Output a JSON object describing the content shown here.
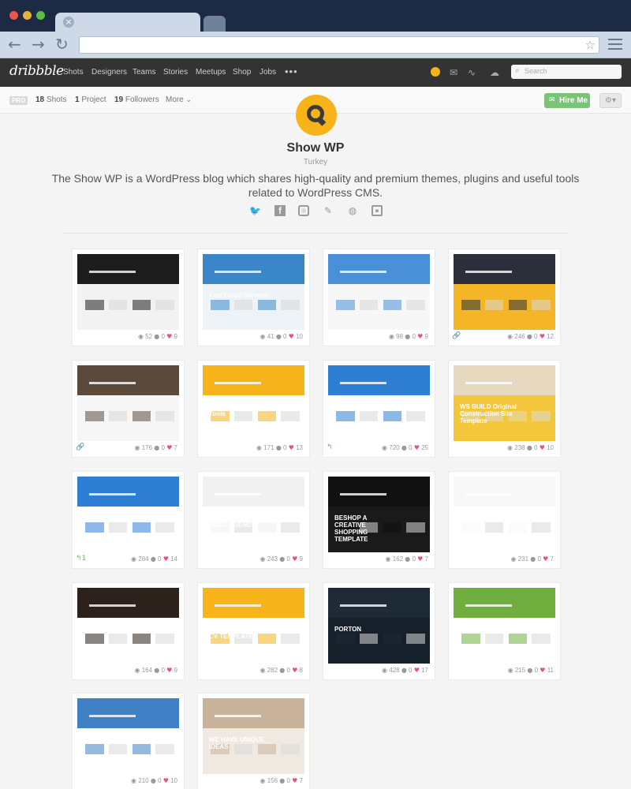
{
  "browser": {
    "tab_close": "×",
    "back_glyph": "←",
    "forward_glyph": "→",
    "reload_glyph": "↻",
    "star_glyph": "☆"
  },
  "header": {
    "logo": "dribbble",
    "nav": [
      "Shots",
      "Designers",
      "Teams",
      "Stories",
      "Meetups",
      "Shop",
      "Jobs"
    ],
    "more": "•••",
    "search_placeholder": "Search",
    "icons": [
      "avatar-icon",
      "mail-icon",
      "activity-icon",
      "upload-icon"
    ]
  },
  "profile_bar": {
    "pro": "PRO",
    "shots_count": "18",
    "shots_label": "Shots",
    "projects_count": "1",
    "projects_label": "Project",
    "followers_count": "19",
    "followers_label": "Followers",
    "more_label": "More",
    "more_chevron": "⌄",
    "hire_label": "Hire Me",
    "gear_glyph": "⚙▾"
  },
  "profile": {
    "name": "Show WP",
    "location": "Turkey",
    "bio": "The Show WP is a WordPress blog which shares high-quality and premium themes, plugins and useful tools related to WordPress CMS.",
    "socials": [
      "twitter-icon",
      "facebook-icon",
      "instagram-icon",
      "tag-icon",
      "globe-icon",
      "briefcase-icon"
    ]
  },
  "shots": [
    {
      "views": "52",
      "comments": "0",
      "likes": "9",
      "accent": "#1d1d1d",
      "bg": "#f2f2f2",
      "title": "",
      "corner": ""
    },
    {
      "views": "41",
      "comments": "0",
      "likes": "10",
      "accent": "#3a86c8",
      "bg": "#eef3f8",
      "title": "Fast Cloud Servers!",
      "corner": ""
    },
    {
      "views": "98",
      "comments": "0",
      "likes": "9",
      "accent": "#4a90d9",
      "bg": "#f7f7f7",
      "title": "",
      "corner": ""
    },
    {
      "views": "246",
      "comments": "0",
      "likes": "12",
      "accent": "#2a2f3a",
      "bg": "#f4b626",
      "title": "",
      "corner": "link"
    },
    {
      "views": "176",
      "comments": "0",
      "likes": "7",
      "accent": "#5b4a3c",
      "bg": "#f6f6f6",
      "title": "",
      "corner": "link"
    },
    {
      "views": "171",
      "comments": "0",
      "likes": "13",
      "accent": "#f6b31a",
      "bg": "#ffffff",
      "title": "WordPress SEO Tools",
      "corner": ""
    },
    {
      "views": "720",
      "comments": "0",
      "likes": "25",
      "accent": "#2e7fd4",
      "bg": "#ffffff",
      "title": "",
      "corner": "rebound"
    },
    {
      "views": "238",
      "comments": "0",
      "likes": "10",
      "accent": "#e6d9bf",
      "bg": "#f3c73c",
      "title": "WS BUILD Original Construction Site Template",
      "corner": ""
    },
    {
      "views": "284",
      "comments": "0",
      "likes": "14",
      "accent": "#2e7fd4",
      "bg": "#ffffff",
      "title": "",
      "corner": "rebound1"
    },
    {
      "views": "243",
      "comments": "0",
      "likes": "9",
      "accent": "#f1f1f1",
      "bg": "#ffffff",
      "title": "SHOPPIE 2016 MODA TRENDS",
      "corner": ""
    },
    {
      "views": "162",
      "comments": "0",
      "likes": "7",
      "accent": "#111111",
      "bg": "#1a1a1a",
      "title": "BESHOP A CREATIVE SHOPPING TEMPLATE",
      "corner": ""
    },
    {
      "views": "231",
      "comments": "0",
      "likes": "7",
      "accent": "#f8f8f8",
      "bg": "#ffffff",
      "title": "",
      "corner": ""
    },
    {
      "views": "164",
      "comments": "0",
      "likes": "9",
      "accent": "#2c211b",
      "bg": "#ffffff",
      "title": "",
      "corner": ""
    },
    {
      "views": "282",
      "comments": "0",
      "likes": "8",
      "accent": "#f6b31a",
      "bg": "#ffffff",
      "title": "CVPRESS RESUME CV TEMPLATE",
      "corner": ""
    },
    {
      "views": "428",
      "comments": "0",
      "likes": "17",
      "accent": "#1f2a37",
      "bg": "#16202b",
      "title": "PORTON",
      "corner": ""
    },
    {
      "views": "215",
      "comments": "0",
      "likes": "11",
      "accent": "#6fae3f",
      "bg": "#ffffff",
      "title": "",
      "corner": ""
    },
    {
      "views": "210",
      "comments": "0",
      "likes": "10",
      "accent": "#3f7fc4",
      "bg": "#ffffff",
      "title": "",
      "corner": ""
    },
    {
      "views": "156",
      "comments": "0",
      "likes": "7",
      "accent": "#c9b29a",
      "bg": "#efe9e2",
      "title": "WE HAVE UNIQUE IDEAS",
      "corner": ""
    }
  ],
  "glyphs": {
    "view": "◉",
    "comment": "●",
    "like": "♥",
    "link": "🔗",
    "rebound": "↰"
  }
}
